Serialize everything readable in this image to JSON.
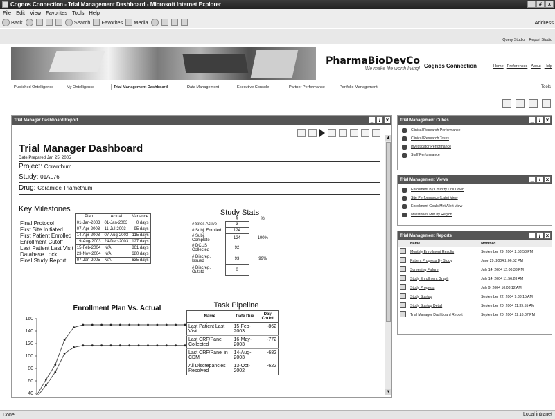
{
  "window": {
    "title": "Cognos Connection - Trial Management Dashboard - Microsoft Internet Explorer",
    "controls": [
      "_",
      "#",
      "x"
    ]
  },
  "menu": [
    "File",
    "Edit",
    "View",
    "Favorites",
    "Tools",
    "Help"
  ],
  "toolbar": {
    "back": "Back",
    "search": "Search",
    "favorites": "Favorites",
    "media": "Media",
    "address": "Address"
  },
  "top_links": [
    "Query Studio",
    "Report Studio"
  ],
  "brand": {
    "name": "PharmaBioDevCo",
    "tagline": "We make life worth living!",
    "product": "Cognos Connection"
  },
  "header_links": [
    "Home",
    "Preferences",
    "About",
    "Help"
  ],
  "tabs": [
    "Published Ontelligence",
    "My Ontelligence",
    "Trial Management Dashboard",
    "Data Management",
    "Executive Console",
    "Partner Performance",
    "Portfolio Management"
  ],
  "tools_label": "Tools",
  "report_portlet": {
    "title": "Trial Manager Dashboard Report",
    "dashboard_title": "Trial Manager Dashboard",
    "date_prepared": "Date Prepared Jan 25, 2005",
    "project_label": "Project:",
    "project": "Coranthum",
    "study_label": "Study:",
    "study": "01AL76",
    "drug_label": "Drug:",
    "drug": "Coramide Triamethum",
    "milestones_title": "Key Milestones",
    "milestone_columns": [
      "Plan",
      "Actual",
      "Variance"
    ],
    "milestones": [
      {
        "name": "Final Protocol",
        "plan": "01-Jan-2003",
        "actual": "01-Jan-2003",
        "variance": "0 days"
      },
      {
        "name": "First Site Initiated",
        "plan": "07-Apr-2003",
        "actual": "11-Jul-2003",
        "variance": "95 days"
      },
      {
        "name": "First Patient Enrolled",
        "plan": "14-Apr-2003",
        "actual": "07-Aug-2003",
        "variance": "115 days"
      },
      {
        "name": "Enrollment Cutoff",
        "plan": "19-Aug-2003",
        "actual": "24-Dec-2003",
        "variance": "127 days"
      },
      {
        "name": "Last Patient Last Visit",
        "plan": "15-Feb-2004",
        "actual": "N/A",
        "variance": "861 days"
      },
      {
        "name": "Database Lock",
        "plan": "23-Nov-2004",
        "actual": "N/A",
        "variance": "680 days"
      },
      {
        "name": "Final Study Report",
        "plan": "07-Jan-2005",
        "actual": "N/A",
        "variance": "635 days"
      }
    ],
    "stats_title": "Study Stats",
    "stats_columns": [
      "#",
      "%"
    ],
    "stats": [
      {
        "label": "# Sites Active",
        "value": "3",
        "pct": ""
      },
      {
        "label": "# Subj. Enrolled",
        "value": "124",
        "pct": ""
      },
      {
        "label": "# Subj. Complete",
        "value": "124",
        "pct": "100%"
      },
      {
        "label": "# DCUS Collected",
        "value": "92",
        "pct": ""
      },
      {
        "label": "# Discrep. Issued",
        "value": "93",
        "pct": "99%"
      },
      {
        "label": "# Discrep. Outstd",
        "value": "0",
        "pct": ""
      }
    ],
    "pipeline_title": "Task Pipeline",
    "pipeline_columns": [
      "Name",
      "Date Due",
      "Day Count"
    ],
    "pipeline": [
      {
        "name": "Last Patient Last Visit",
        "date": "15-Feb-2003",
        "count": "-862"
      },
      {
        "name": "Last CRF/Panel Collected",
        "date": "16-May-2003",
        "count": "-772"
      },
      {
        "name": "Last CRF/Panel in CDM",
        "date": "14-Aug-2003",
        "count": "-682"
      },
      {
        "name": "All Discrepancies Resolved",
        "date": "13-Oct-2002",
        "count": "-622"
      }
    ],
    "chart_title": "Enrollment Plan Vs. Actual"
  },
  "chart_data": {
    "type": "line",
    "title": "Enrollment Plan Vs. Actual",
    "xlabel": "",
    "ylabel": "",
    "ylim": [
      40,
      160
    ],
    "yticks": [
      40,
      60,
      80,
      100,
      120,
      140,
      160
    ],
    "x": [
      1,
      2,
      3,
      4,
      5,
      6,
      7,
      8,
      9,
      10,
      11,
      12,
      13,
      14,
      15,
      16,
      17
    ],
    "series": [
      {
        "values": [
          37,
          62,
          86,
          126,
          146,
          150,
          150,
          150,
          150,
          150,
          150,
          150,
          150,
          150,
          150,
          150,
          150
        ]
      },
      {
        "values": [
          34,
          53,
          74,
          104,
          114,
          117,
          117,
          117,
          117,
          117,
          117,
          117,
          117,
          117,
          117,
          117,
          117
        ]
      }
    ],
    "grid": false,
    "legend": "none"
  },
  "cubes_portlet": {
    "title": "Trial Management Cubes",
    "items": [
      "Clinical Research Performance",
      "Clinical Research Tasks",
      "Investigator Performance",
      "Staff Performance"
    ]
  },
  "views_portlet": {
    "title": "Trial Management Views",
    "items": [
      "Enrollment By Country Drill Down",
      "Site Performance (Late) View",
      "Enrollment Goals Met Alert View",
      "Milestones Met by Region"
    ]
  },
  "reports_portlet": {
    "title": "Trial Management Reports",
    "columns": [
      "Name",
      "Modified"
    ],
    "rows": [
      {
        "name": "Monthly Enrollment Results",
        "modified": "September 29, 2004 2:53:53 PM"
      },
      {
        "name": "Patient Progress By Study",
        "modified": "June 29, 2004 2:06:52 PM"
      },
      {
        "name": "Screening Failure",
        "modified": "July 14, 2004 12:00:38 PM"
      },
      {
        "name": "Study Enrollment Graph",
        "modified": "July 14, 2004 11:56:28 AM"
      },
      {
        "name": "Study Progress",
        "modified": "July 9, 2004 10:08:12 AM"
      },
      {
        "name": "Study Startup",
        "modified": "September 22, 2004 9:38:15 AM"
      },
      {
        "name": "Study Startup Detail",
        "modified": "September 20, 2004 11:39:55 AM"
      },
      {
        "name": "Trial Manager Dashboard Report",
        "modified": "September 20, 2004 12:16:07 PM"
      }
    ]
  },
  "status": {
    "left": "Done",
    "right": "Local intranet"
  }
}
